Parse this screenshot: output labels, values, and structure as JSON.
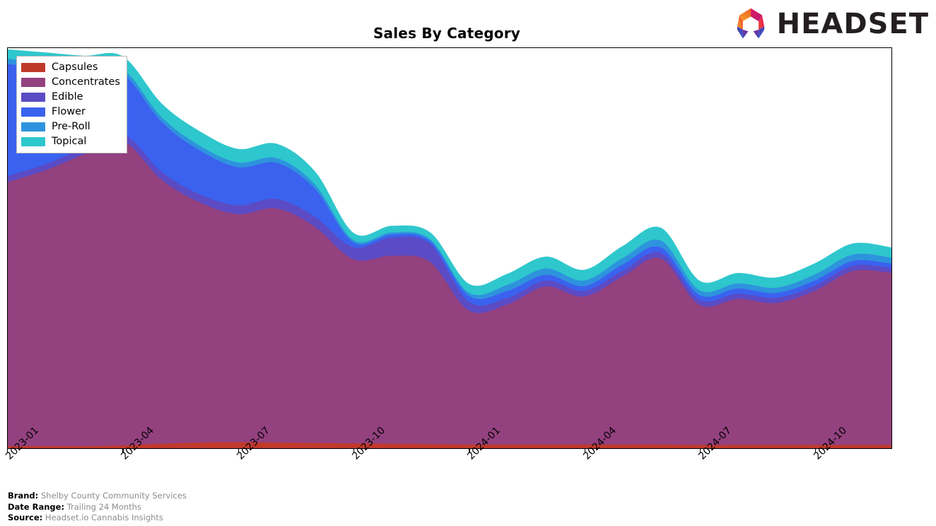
{
  "header": {
    "title": "Sales By Category",
    "logo_wordmark": "HEADSET",
    "logo_icon": "headset-hexagon-logo"
  },
  "footer": {
    "rows": [
      {
        "key": "Brand:",
        "value": "Shelby County Community Services"
      },
      {
        "key": "Date Range:",
        "value": "Trailing 24 Months"
      },
      {
        "key": "Source:",
        "value": "Headset.io Cannabis Insights"
      }
    ]
  },
  "legend": {
    "position": "top-left-inside",
    "items": [
      {
        "label": "Capsules",
        "color": "#c0392b"
      },
      {
        "label": "Concentrates",
        "color": "#94417f"
      },
      {
        "label": "Edible",
        "color": "#5b4bc4"
      },
      {
        "label": "Flower",
        "color": "#3b62ee"
      },
      {
        "label": "Pre-Roll",
        "color": "#2e93dd"
      },
      {
        "label": "Topical",
        "color": "#2ec7cd"
      }
    ]
  },
  "chart_data": {
    "type": "area",
    "stacked": true,
    "title": "Sales By Category",
    "xlabel": "",
    "ylabel": "",
    "grid": false,
    "smoothing": "spline",
    "x": [
      "2023-01",
      "2023-02",
      "2023-03",
      "2023-04",
      "2023-05",
      "2023-06",
      "2023-07",
      "2023-08",
      "2023-09",
      "2023-10",
      "2023-11",
      "2023-12",
      "2024-01",
      "2024-02",
      "2024-03",
      "2024-04",
      "2024-05",
      "2024-06",
      "2024-07",
      "2024-08",
      "2024-09",
      "2024-10",
      "2024-11",
      "2024-12"
    ],
    "tick_labels": [
      "2023-01",
      "2023-04",
      "2023-07",
      "2023-10",
      "2024-01",
      "2024-04",
      "2024-07",
      "2024-10"
    ],
    "tick_positions": [
      0,
      3,
      6,
      9,
      12,
      15,
      18,
      21
    ],
    "ylim": [
      0,
      100
    ],
    "series": [
      {
        "name": "Capsules",
        "color": "#c0392b",
        "values": [
          0.6,
          0.6,
          0.6,
          0.8,
          1.2,
          1.5,
          1.6,
          1.5,
          1.4,
          1.3,
          1.2,
          1.1,
          1.0,
          1.0,
          1.0,
          1.0,
          1.0,
          1.0,
          0.9,
          0.9,
          0.9,
          0.9,
          0.9,
          0.9
        ]
      },
      {
        "name": "Concentrates",
        "color": "#94417f",
        "values": [
          66.0,
          69.0,
          73.0,
          76.0,
          66.0,
          60.0,
          57.0,
          58.5,
          54.0,
          46.0,
          47.0,
          45.5,
          33.5,
          35.0,
          39.5,
          37.0,
          42.0,
          46.5,
          35.0,
          36.5,
          35.5,
          38.5,
          43.5,
          43.0
        ]
      },
      {
        "name": "Edible",
        "color": "#5b4bc4",
        "values": [
          1.5,
          1.5,
          1.6,
          1.8,
          2.0,
          2.0,
          2.2,
          2.4,
          2.5,
          3.0,
          4.5,
          4.5,
          2.2,
          1.6,
          1.5,
          1.4,
          1.4,
          1.4,
          1.3,
          1.3,
          1.3,
          1.3,
          1.3,
          1.2
        ]
      },
      {
        "name": "Flower",
        "color": "#3b62ee",
        "values": [
          28.0,
          24.0,
          19.0,
          15.0,
          12.5,
          11.0,
          9.5,
          9.0,
          7.0,
          1.2,
          0.8,
          0.7,
          1.5,
          1.8,
          1.4,
          1.2,
          1.6,
          1.4,
          1.2,
          1.3,
          1.2,
          1.3,
          1.2,
          1.1
        ]
      },
      {
        "name": "Pre-Roll",
        "color": "#2e93dd",
        "values": [
          1.3,
          1.3,
          1.2,
          1.2,
          1.2,
          1.2,
          1.2,
          1.2,
          1.1,
          0.6,
          0.5,
          0.5,
          0.8,
          1.5,
          1.6,
          1.4,
          1.6,
          1.7,
          1.2,
          1.3,
          1.3,
          1.5,
          1.6,
          1.5
        ]
      },
      {
        "name": "Topical",
        "color": "#2ec7cd",
        "values": [
          2.2,
          2.4,
          2.6,
          3.0,
          3.2,
          3.4,
          3.2,
          3.4,
          3.0,
          1.6,
          1.5,
          1.5,
          2.0,
          2.6,
          2.8,
          2.5,
          2.8,
          3.0,
          2.2,
          2.4,
          2.4,
          2.6,
          2.6,
          2.4
        ]
      }
    ]
  }
}
